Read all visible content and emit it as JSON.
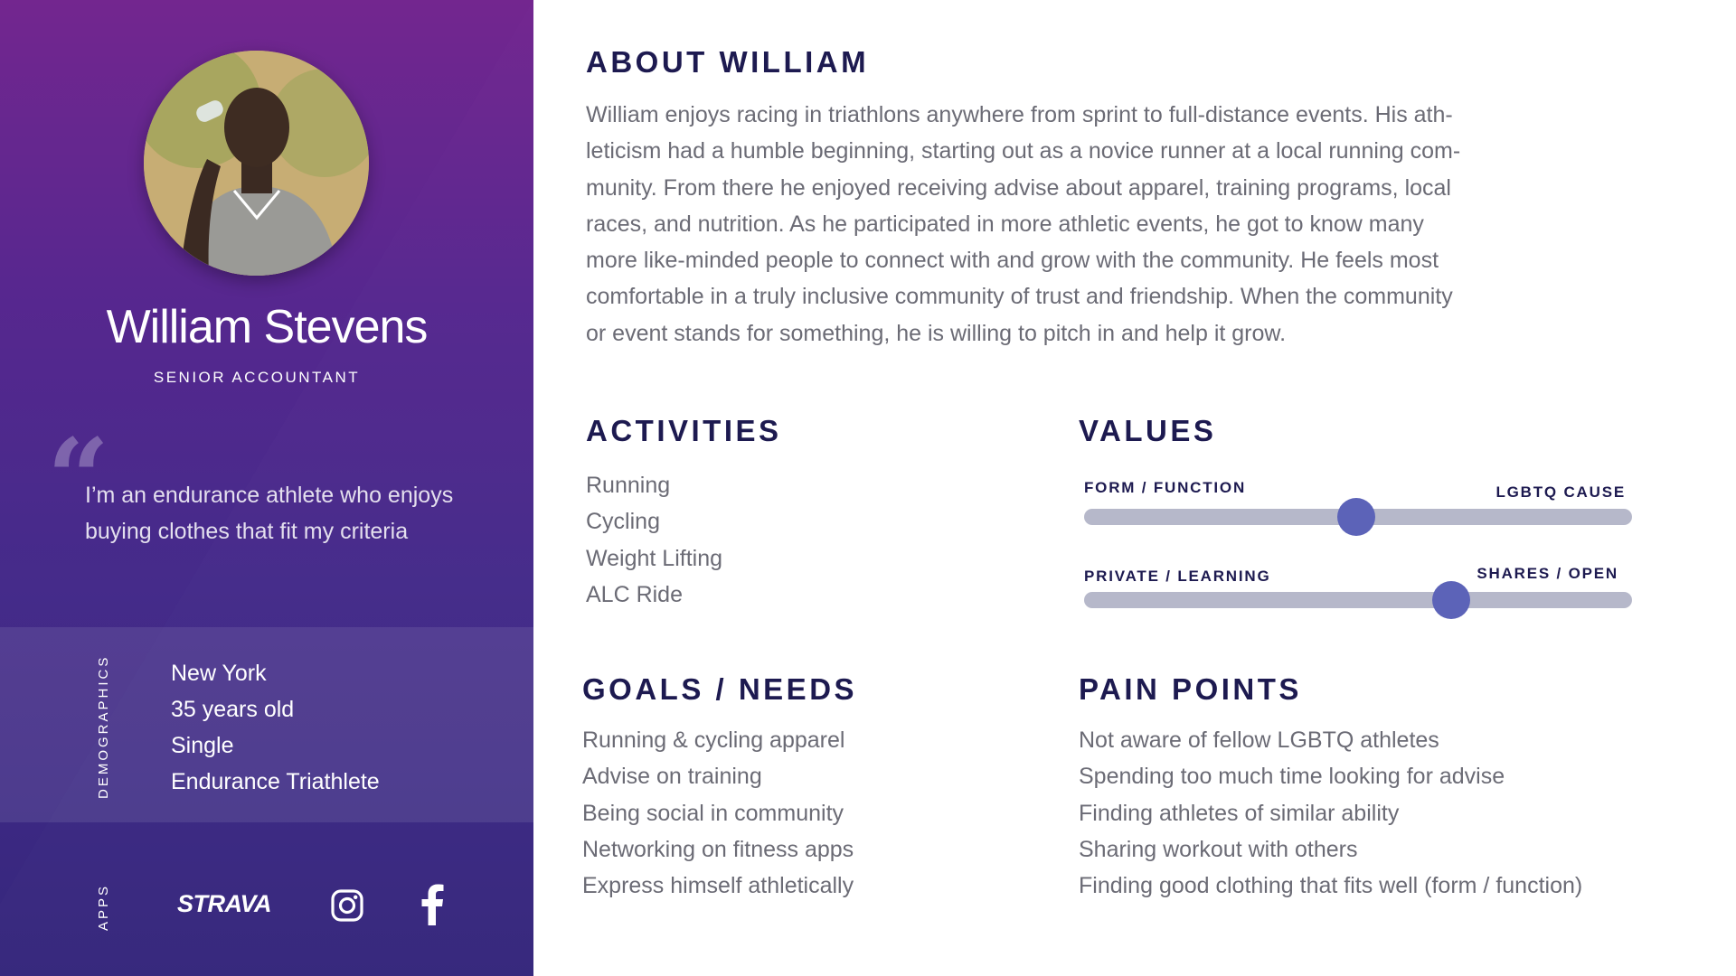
{
  "profile": {
    "name": "William Stevens",
    "role": "SENIOR ACCOUNTANT",
    "quote": "I’m an endurance athlete who enjoys buying clothes that fit my criteria"
  },
  "demographics": {
    "label": "DEMOGRAPHICS",
    "items": [
      "New York",
      "35 years old",
      "Single",
      "Endurance Triathlete"
    ]
  },
  "apps": {
    "label": "APPS",
    "strava": "STRAVA",
    "icons": [
      "strava-logo",
      "instagram-icon",
      "facebook-icon"
    ]
  },
  "about": {
    "title": "ABOUT WILLIAM",
    "lines": [
      "William enjoys racing in triathlons anywhere from sprint to full-distance events.  His ath-",
      "leticism had a humble beginning, starting out as a novice runner at a local running com-",
      "munity.  From there he enjoyed receiving advise about apparel, training programs, local",
      "races, and nutrition.  As he participated in more athletic events, he got to know many",
      "more like-minded people to connect with and grow with the community.  He feels most",
      "comfortable in a truly inclusive community of trust and friendship.  When the community",
      "or event stands for something, he is willing to pitch in and help it grow."
    ]
  },
  "activities": {
    "title": "ACTIVITIES",
    "items": [
      "Running",
      "Cycling",
      "Weight Lifting",
      "ALC Ride"
    ]
  },
  "values": {
    "title": "VALUES",
    "sliders": [
      {
        "left": "FORM / FUNCTION",
        "right": "LGBTQ CAUSE",
        "position": 0.497
      },
      {
        "left": "PRIVATE  / LEARNING",
        "right": "SHARES / OPEN",
        "position": 0.67
      }
    ]
  },
  "goals": {
    "title": "GOALS / NEEDS",
    "items": [
      "Running & cycling apparel",
      "Advise on training",
      "Being social in community",
      "Networking on fitness apps",
      "Express himself athletically"
    ]
  },
  "pain_points": {
    "title": "PAIN POINTS",
    "items": [
      "Not aware of fellow LGBTQ athletes",
      "Spending too much time looking for advise",
      "Finding athletes of similar ability",
      "Sharing workout with others",
      "Finding good clothing that fits well (form / function)"
    ]
  },
  "colors": {
    "heading": "#1d1a50",
    "body_text": "#6b6b75",
    "slider_track": "#b6b8ca",
    "slider_knob": "#5c63b8",
    "sidebar_top": "#6f1f8c",
    "sidebar_bottom": "#2f2178"
  }
}
